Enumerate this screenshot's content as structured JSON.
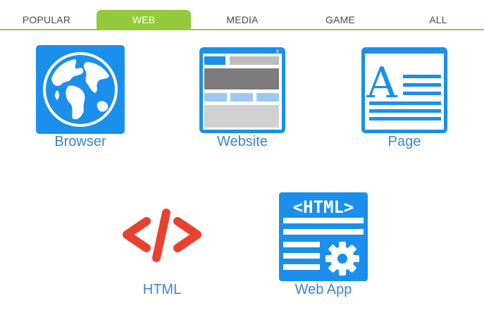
{
  "tabs": [
    {
      "label": "POPULAR",
      "active": false
    },
    {
      "label": "WEB",
      "active": true
    },
    {
      "label": "MEDIA",
      "active": false
    },
    {
      "label": "GAME",
      "active": false
    },
    {
      "label": "ALL",
      "active": false
    }
  ],
  "tiles": [
    {
      "label": "Browser",
      "icon": "globe-icon"
    },
    {
      "label": "Website",
      "icon": "website-layout-icon"
    },
    {
      "label": "Page",
      "icon": "document-page-icon"
    },
    {
      "label": "HTML",
      "icon": "code-brackets-icon"
    },
    {
      "label": "Web App",
      "icon": "web-app-icon",
      "icon_text": "<HTML>"
    }
  ],
  "colors": {
    "accent": "#94c83d",
    "icon_blue": "#1b8fec",
    "label_blue": "#3d84c6",
    "html_red": "#e8412f"
  }
}
